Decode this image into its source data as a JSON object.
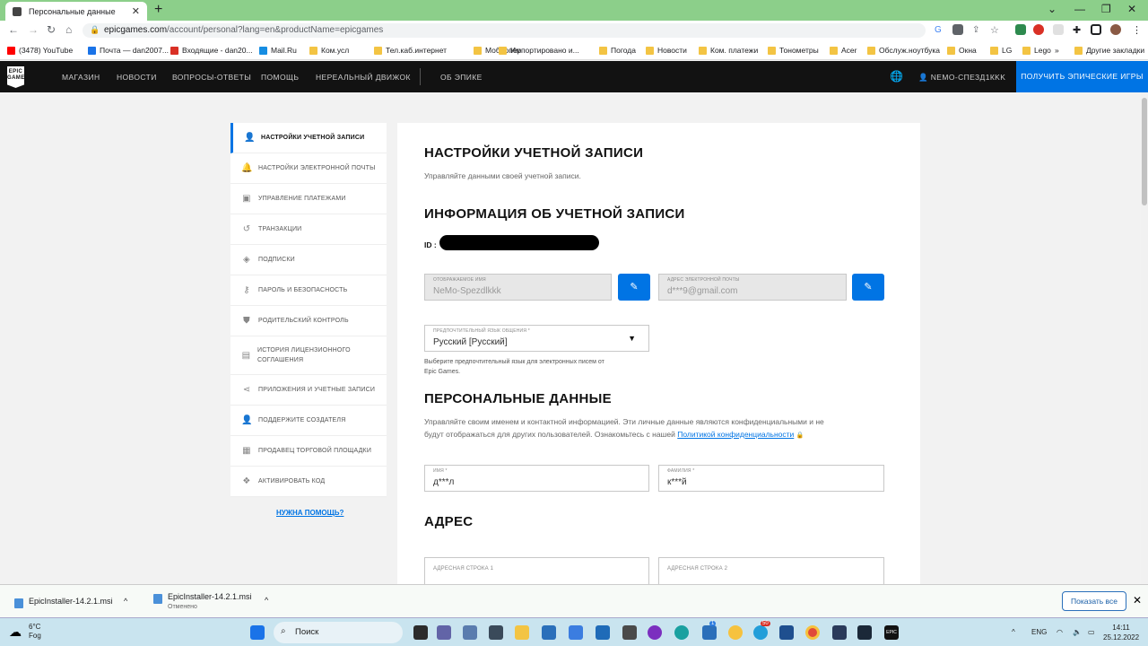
{
  "browser": {
    "tab_title": "Персональные данные",
    "url_host": "epicgames.com",
    "url_path": "/account/personal?lang=en&productName=epicgames"
  },
  "bookmarks": [
    {
      "label": "(3478) YouTube",
      "color": "#ff0000"
    },
    {
      "label": "Почта — dan2007...",
      "color": "#1a73e8"
    },
    {
      "label": "Входящие - dan20...",
      "color": "#d93025"
    },
    {
      "label": "Mail.Ru",
      "color": "#168de2"
    },
    {
      "label": "Ком.усл",
      "color": "#f3c443"
    },
    {
      "label": "Тел.каб.интернет",
      "color": "#f3c443"
    },
    {
      "label": "Моб. опер",
      "color": "#f3c443"
    },
    {
      "label": "Импортировано и...",
      "color": "#f3c443"
    },
    {
      "label": "Погода",
      "color": "#f3c443"
    },
    {
      "label": "Новости",
      "color": "#f3c443"
    },
    {
      "label": "Ком. платежи",
      "color": "#f3c443"
    },
    {
      "label": "Тонометры",
      "color": "#f3c443"
    },
    {
      "label": "Acer",
      "color": "#f3c443"
    },
    {
      "label": "Обслуж.ноутбука",
      "color": "#f3c443"
    },
    {
      "label": "Окна",
      "color": "#f3c443"
    },
    {
      "label": "LG",
      "color": "#f3c443"
    },
    {
      "label": "Lego",
      "color": "#f3c443"
    }
  ],
  "bookmarks_more": "»",
  "bookmarks_other": "Другие закладки",
  "epic_nav": {
    "logo": "EPIC GAMES",
    "items": [
      "МАГАЗИН",
      "НОВОСТИ",
      "ВОПРОСЫ-ОТВЕТЫ",
      "ПОМОЩЬ",
      "НЕРЕАЛЬНЫЙ ДВИЖОК",
      "ОБ ЭПИКЕ"
    ],
    "username": "NEMO-СПЕЗД1КKK",
    "get_button": "ПОЛУЧИТЬ ЭПИЧЕСКИЕ ИГРЫ"
  },
  "sidebar": {
    "items": [
      {
        "label": "НАСТРОЙКИ УЧЕТНОЙ ЗАПИСИ",
        "icon": "person-icon",
        "glyph": "👤"
      },
      {
        "label": "НАСТРОЙКИ ЭЛЕКТРОННОЙ ПОЧТЫ",
        "icon": "bell-icon",
        "glyph": "🔔"
      },
      {
        "label": "УПРАВЛЕНИЕ ПЛАТЕЖАМИ",
        "icon": "wallet-icon",
        "glyph": "▣"
      },
      {
        "label": "ТРАНЗАКЦИИ",
        "icon": "history-icon",
        "glyph": "↺"
      },
      {
        "label": "ПОДПИСКИ",
        "icon": "tag-icon",
        "glyph": "◈"
      },
      {
        "label": "ПАРОЛЬ И БЕЗОПАСНОСТЬ",
        "icon": "key-icon",
        "glyph": "⚷"
      },
      {
        "label": "РОДИТЕЛЬСКИЙ КОНТРОЛЬ",
        "icon": "shield-icon",
        "glyph": "⛊"
      },
      {
        "label": "ИСТОРИЯ ЛИЦЕНЗИОННОГО СОГЛАШЕНИЯ",
        "icon": "clipboard-icon",
        "glyph": "▤"
      },
      {
        "label": "ПРИЛОЖЕНИЯ И УЧЕТНЫЕ ЗАПИСИ",
        "icon": "share-icon",
        "glyph": "⋖"
      },
      {
        "label": "ПОДДЕРЖИТЕ СОЗДАТЕЛЯ",
        "icon": "creator-icon",
        "glyph": "👤"
      },
      {
        "label": "ПРОДАВЕЦ ТОРГОВОЙ ПЛОЩАДКИ",
        "icon": "store-icon",
        "glyph": "▦"
      },
      {
        "label": "АКТИВИРОВАТЬ КОД",
        "icon": "gift-icon",
        "glyph": "❖"
      }
    ],
    "help_link": "НУЖНА ПОМОЩЬ?"
  },
  "main": {
    "title": "НАСТРОЙКИ УЧЕТНОЙ ЗАПИСИ",
    "subtitle": "Управляйте данными своей учетной записи.",
    "account_info_title": "ИНФОРМАЦИЯ ОБ УЧЕТНОЙ ЗАПИСИ",
    "id_label": "ID :",
    "display_name_label": "ОТОБРАЖАЕМОЕ ИМЯ",
    "display_name_value": "NeMo-Spezdlkkk",
    "email_label": "АДРЕС ЭЛЕКТРОННОЙ ПОЧТЫ",
    "email_value": "d***9@gmail.com",
    "language_label": "ПРЕДПОЧТИТЕЛЬНЫЙ ЯЗЫК ОБЩЕНИЯ *",
    "language_value": "Русский [Русский]",
    "language_hint_1": "Выберите предпочтительный язык для электронных писем от",
    "language_hint_2": "Epic Games.",
    "personal_title": "ПЕРСОНАЛЬНЫЕ ДАННЫЕ",
    "personal_desc_1": "Управляйте своим именем и контактной информацией. Эти личные данные являются конфиденциальными и не",
    "personal_desc_2": "будут отображаться для других пользователей. Ознакомьтесь с нашей",
    "privacy_link": "Политикой конфиденциальности",
    "first_name_label": "ИМЯ *",
    "first_name_value": "д***л",
    "last_name_label": "ФАМИЛИЯ *",
    "last_name_value": "к***й",
    "address_title": "АДРЕС",
    "address1_label": "АДРЕСНАЯ СТРОКА 1",
    "address2_label": "АДРЕСНАЯ СТРОКА 2"
  },
  "downloads": {
    "items": [
      {
        "name": "EpicInstaller-14.2.1.msi",
        "status": ""
      },
      {
        "name": "EpicInstaller-14.2.1.msi",
        "status": "Отменено"
      }
    ],
    "show_all": "Показать все"
  },
  "taskbar": {
    "temp": "6°C",
    "weather": "Fog",
    "search": "Поиск",
    "lang": "ENG",
    "time": "14:11",
    "date": "25.12.2022",
    "badge_1": "1",
    "badge_2": "50"
  }
}
